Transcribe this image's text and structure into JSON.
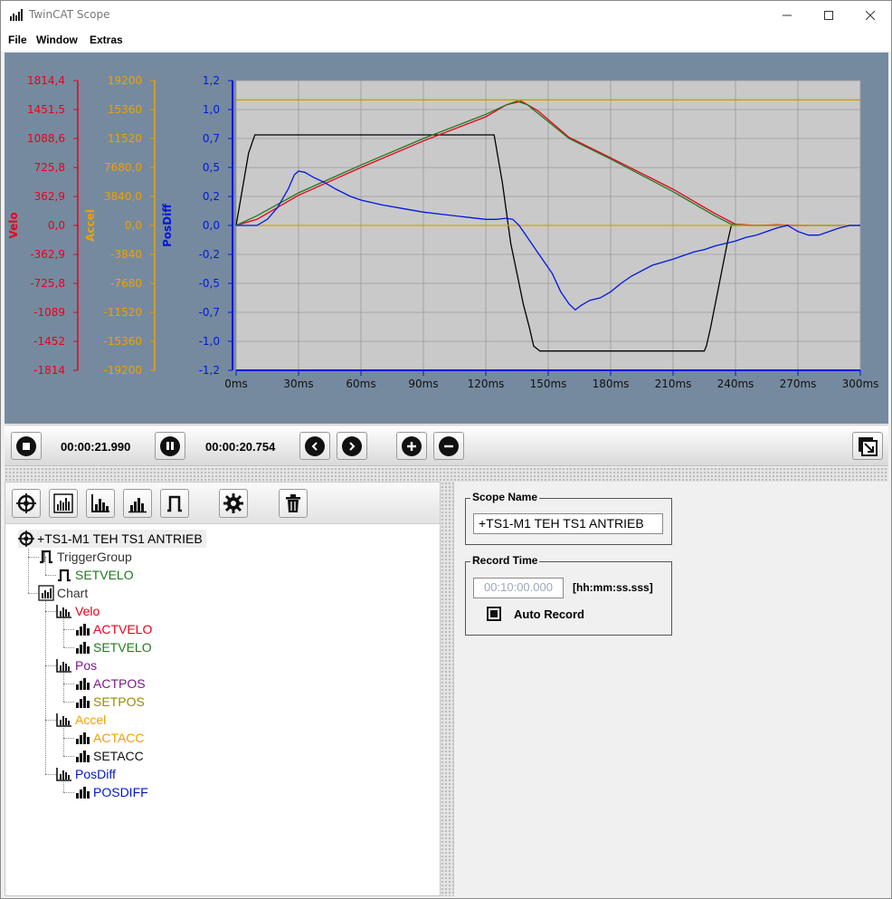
{
  "window": {
    "title": "TwinCAT Scope"
  },
  "menu": {
    "file": "File",
    "window": "Window",
    "extras": "Extras"
  },
  "axes": {
    "velo": {
      "label": "Velo",
      "color": "#e8001c",
      "ticks": [
        "1814,4",
        "1451,5",
        "1088,6",
        "725,8",
        "362,9",
        "0,0",
        "-362,9",
        "-725,8",
        "-1089",
        "-1452",
        "-1814"
      ]
    },
    "accel": {
      "label": "Accel",
      "color": "#f0a000",
      "ticks": [
        "19200",
        "15360",
        "11520",
        "7680,0",
        "3840,0",
        "0,0",
        "-3840",
        "-7680",
        "-11520",
        "-15360",
        "-19200"
      ]
    },
    "posdiff": {
      "label": "PosDiff",
      "color": "#0018e0",
      "ticks": [
        "1,2",
        "1,0",
        "0,7",
        "0,5",
        "0,2",
        "0,0",
        "-0,2",
        "-0,5",
        "-0,7",
        "-1,0",
        "-1,2"
      ]
    },
    "x_ticks": [
      "0ms",
      "30ms",
      "60ms",
      "90ms",
      "120ms",
      "150ms",
      "180ms",
      "210ms",
      "240ms",
      "270ms",
      "300ms"
    ]
  },
  "chart_data": {
    "type": "line",
    "xlabel": "",
    "xlim": [
      0,
      300
    ],
    "ylim": [
      -1.2,
      1.2
    ],
    "grid": true,
    "series": [
      {
        "color": "#000000",
        "x": [
          0,
          3,
          6,
          9,
          12,
          15,
          120,
          124,
          126,
          128,
          130,
          132,
          135,
          138,
          141,
          143,
          146,
          148,
          220,
          225,
          226,
          228,
          232,
          236,
          238,
          240,
          244,
          300
        ],
        "y": [
          0,
          0.3,
          0.6,
          0.75,
          0.75,
          0.75,
          0.75,
          0.75,
          0.55,
          0.35,
          0.1,
          -0.15,
          -0.4,
          -0.65,
          -0.85,
          -1.0,
          -1.04,
          -1.04,
          -1.04,
          -1.04,
          -1.0,
          -0.85,
          -0.5,
          -0.15,
          0,
          0,
          0,
          0
        ]
      },
      {
        "color": "#e8001c",
        "x": [
          0,
          10,
          30,
          60,
          90,
          120,
          130,
          137,
          145,
          160,
          180,
          210,
          230,
          240,
          250,
          260,
          270,
          275
        ],
        "y": [
          0,
          0.05,
          0.25,
          0.48,
          0.7,
          0.9,
          1.0,
          1.03,
          0.95,
          0.73,
          0.56,
          0.3,
          0.1,
          0.01,
          0,
          0.005,
          0.0,
          0.0
        ]
      },
      {
        "color": "#1f7a1f",
        "x": [
          0,
          10,
          30,
          60,
          90,
          120,
          130,
          135,
          140,
          160,
          180,
          210,
          230,
          238,
          245,
          260,
          270
        ],
        "y": [
          0,
          0.08,
          0.27,
          0.5,
          0.72,
          0.92,
          1.0,
          1.03,
          1.0,
          0.72,
          0.55,
          0.28,
          0.08,
          0.01,
          0.0,
          0.0,
          0.0
        ]
      },
      {
        "color": "#c8a000",
        "x": [
          0,
          300
        ],
        "y": [
          1.04,
          1.04
        ]
      },
      {
        "color": "#e0a000",
        "x": [
          0,
          300
        ],
        "y": [
          0,
          0
        ]
      },
      {
        "color": "#0018e0",
        "x": [
          0,
          5,
          10,
          15,
          20,
          25,
          28,
          30,
          33,
          37,
          42,
          48,
          55,
          60,
          70,
          80,
          90,
          100,
          110,
          120,
          125,
          130,
          133,
          136,
          140,
          144,
          148,
          152,
          156,
          160,
          163,
          166,
          170,
          175,
          180,
          185,
          190,
          200,
          210,
          215,
          220,
          225,
          230,
          235,
          240,
          245,
          250,
          255,
          260,
          265,
          270,
          275,
          280,
          285,
          290,
          295,
          300
        ],
        "y": [
          0,
          0,
          0,
          0.05,
          0.15,
          0.3,
          0.42,
          0.45,
          0.44,
          0.4,
          0.36,
          0.3,
          0.24,
          0.21,
          0.17,
          0.14,
          0.11,
          0.09,
          0.07,
          0.05,
          0.05,
          0.06,
          0.05,
          0.0,
          -0.1,
          -0.2,
          -0.3,
          -0.4,
          -0.55,
          -0.65,
          -0.7,
          -0.66,
          -0.62,
          -0.6,
          -0.55,
          -0.48,
          -0.42,
          -0.33,
          -0.28,
          -0.25,
          -0.22,
          -0.2,
          -0.17,
          -0.15,
          -0.13,
          -0.1,
          -0.08,
          -0.05,
          -0.02,
          0.0,
          -0.05,
          -0.08,
          -0.08,
          -0.05,
          -0.02,
          0.0,
          0.0
        ]
      }
    ]
  },
  "playback": {
    "time1": "00:00:21.990",
    "time2": "00:00:20.754"
  },
  "tree": {
    "root": "+TS1-M1 TEH TS1 ANTRIEB",
    "trigger_group": "TriggerGroup",
    "trigger_setvelo": "SETVELO",
    "chart": "Chart",
    "velo": "Velo",
    "actvelo": "ACTVELO",
    "setvelo": "SETVELO",
    "pos": "Pos",
    "actpos": "ACTPOS",
    "setpos": "SETPOS",
    "accel": "Accel",
    "actacc": "ACTACC",
    "setacc": "SETACC",
    "posdiff": "PosDiff",
    "posdiff_ch": "POSDIFF"
  },
  "props": {
    "scope_name_title": "Scope Name",
    "scope_name_value": "+TS1-M1 TEH TS1 ANTRIEB",
    "record_time_title": "Record Time",
    "record_time_value": "00:10:00.000",
    "record_time_unit": "[hh:mm:ss.sss]",
    "auto_record_label": "Auto Record"
  }
}
